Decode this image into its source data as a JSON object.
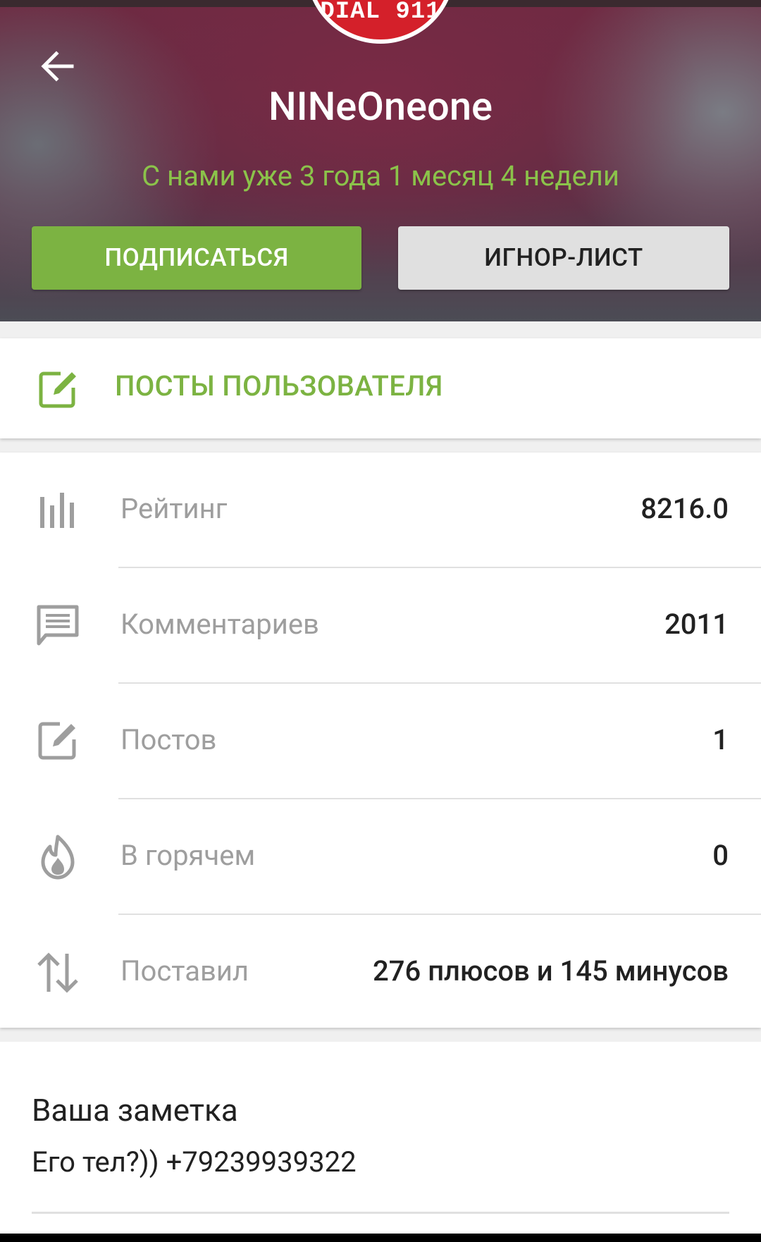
{
  "profile": {
    "avatar_text": "DIAL 911",
    "username": "NINeOneone",
    "member_since": "С нами уже 3 года 1 месяц 4 недели",
    "subscribe_label": "ПОДПИСАТЬСЯ",
    "ignore_label": "ИГНОР-ЛИСТ"
  },
  "posts_link": {
    "label": "ПОСТЫ ПОЛЬЗОВАТЕЛЯ",
    "icon": "edit-icon"
  },
  "stats": [
    {
      "icon": "chart-bars-icon",
      "label": "Рейтинг",
      "value": "8216.0"
    },
    {
      "icon": "comment-icon",
      "label": "Комментариев",
      "value": "2011"
    },
    {
      "icon": "edit-icon",
      "label": "Постов",
      "value": "1"
    },
    {
      "icon": "flame-icon",
      "label": "В горячем",
      "value": "0"
    },
    {
      "icon": "swap-vertical-icon",
      "label": "Поставил",
      "value": "276 плюсов и 145 минусов"
    }
  ],
  "note": {
    "title": "Ваша заметка",
    "text": "Его тел?)) +79239939322"
  },
  "colors": {
    "accent_green": "#7cb342",
    "member_since_green": "#8bc34a",
    "header_maroon": "#6e2a42",
    "avatar_red": "#d4202a"
  }
}
